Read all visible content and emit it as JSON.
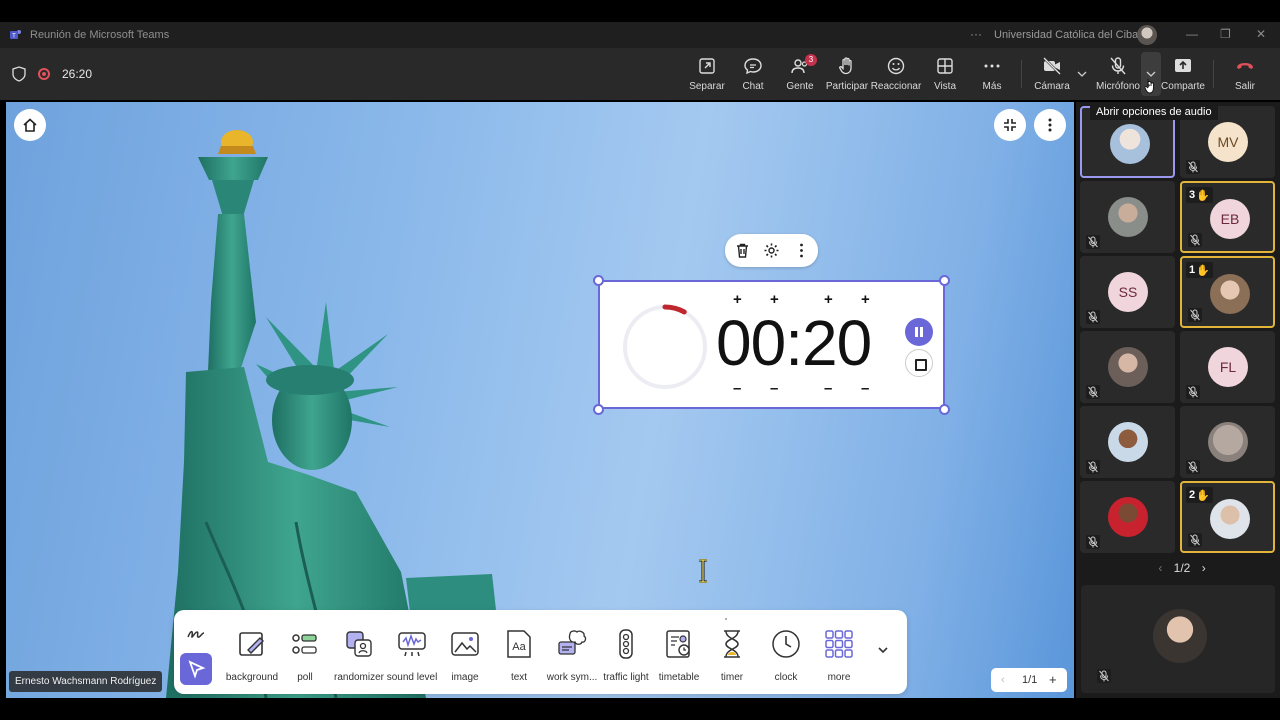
{
  "window": {
    "title": "Reunión de Microsoft Teams",
    "organization": "Universidad Católica del Cibao"
  },
  "meeting": {
    "elapsed": "26:20",
    "toolbar": [
      {
        "name": "separar",
        "label": "Separar"
      },
      {
        "name": "chat",
        "label": "Chat"
      },
      {
        "name": "gente",
        "label": "Gente",
        "badge": "3"
      },
      {
        "name": "participar",
        "label": "Participar"
      },
      {
        "name": "reaccionar",
        "label": "Reaccionar"
      },
      {
        "name": "vista",
        "label": "Vista"
      },
      {
        "name": "mas",
        "label": "Más"
      },
      {
        "name": "camara",
        "label": "Cámara"
      },
      {
        "name": "microfono",
        "label": "Micrófono"
      },
      {
        "name": "comparte",
        "label": "Comparte"
      },
      {
        "name": "salir",
        "label": "Salir"
      }
    ],
    "tooltip": "Abrir opciones de audio"
  },
  "timer_widget": {
    "time": "00:20",
    "remaining_fraction": 0.08,
    "ring_color": "#c0262d",
    "accent": "#6a68d8"
  },
  "tools": [
    {
      "label": "background"
    },
    {
      "label": "poll"
    },
    {
      "label": "randomizer"
    },
    {
      "label": "sound level"
    },
    {
      "label": "image"
    },
    {
      "label": "text"
    },
    {
      "label": "work sym..."
    },
    {
      "label": "traffic light"
    },
    {
      "label": "timetable"
    },
    {
      "label": "timer"
    },
    {
      "label": "clock"
    },
    {
      "label": "more"
    }
  ],
  "pager": {
    "current": "1/1"
  },
  "presenter_name": "Ernesto Wachsmann Rodríguez",
  "participants": {
    "tiles": [
      {
        "initials": "",
        "muted": false,
        "hand": "",
        "active": true
      },
      {
        "initials": "MV",
        "muted": true,
        "hand": ""
      },
      {
        "initials": "",
        "muted": true,
        "hand": ""
      },
      {
        "initials": "EB",
        "muted": true,
        "hand": "3"
      },
      {
        "initials": "SS",
        "muted": true,
        "hand": ""
      },
      {
        "initials": "",
        "muted": true,
        "hand": "1"
      },
      {
        "initials": "",
        "muted": true,
        "hand": ""
      },
      {
        "initials": "FL",
        "muted": true,
        "hand": ""
      },
      {
        "initials": "",
        "muted": true,
        "hand": ""
      },
      {
        "initials": "",
        "muted": true,
        "hand": ""
      },
      {
        "initials": "",
        "muted": true,
        "hand": ""
      },
      {
        "initials": "",
        "muted": true,
        "hand": "2"
      }
    ],
    "page": "1/2"
  }
}
